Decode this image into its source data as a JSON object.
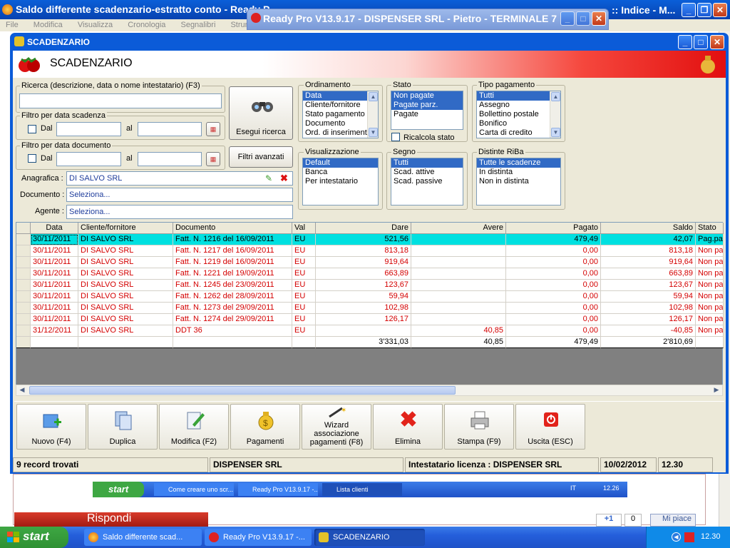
{
  "background": {
    "browser_title": "Saldo differente scadenzario-estratto conto - Ready P",
    "browser_title_right": ":: Indice - M...",
    "menu": [
      "File",
      "Modifica",
      "Visualizza",
      "Cronologia",
      "Segnalibri",
      "Strumenti"
    ],
    "readypro_title": "Ready Pro V13.9.17 - DISPENSER SRL - Pietro - TERMINALE 7",
    "reply_button": "Rispondi",
    "like_count": "0",
    "like_label": "Mi piace",
    "plus_label": "+1",
    "inner_taskbar": {
      "start": "start",
      "items": [
        "Come creare uno scr...",
        "Ready Pro V13.9.17 -...",
        "Lista clienti"
      ],
      "lang": "IT",
      "clock": "12.26"
    }
  },
  "window": {
    "title": "SCADENZARIO",
    "banner": "SCADENZARIO"
  },
  "search": {
    "label": "Ricerca (descrizione, data o nome intestatario) (F3)",
    "value": "",
    "filter_due_label": "Filtro per data scadenza",
    "filter_doc_label": "Filtro per data documento",
    "dal": "Dal",
    "al": "al",
    "run_button": "Esegui ricerca",
    "advanced_button": "Filtri avanzati"
  },
  "fields": {
    "anagrafica_label": "Anagrafica :",
    "anagrafica_value": "DI SALVO SRL",
    "documento_label": "Documento :",
    "documento_value": "Seleziona...",
    "agente_label": "Agente :",
    "agente_value": "Seleziona..."
  },
  "ordinamento": {
    "title": "Ordinamento",
    "items": [
      "Data",
      "Cliente/fornitore",
      "Stato pagamento",
      "Documento",
      "Ord. di inserimento"
    ],
    "selected": [
      0
    ]
  },
  "stato": {
    "title": "Stato",
    "items": [
      "Non pagate",
      "Pagate parz.",
      "Pagate"
    ],
    "selected": [
      0,
      1
    ],
    "ricalcola": "Ricalcola stato"
  },
  "tipo_pagamento": {
    "title": "Tipo pagamento",
    "items": [
      "Tutti",
      "Assegno",
      "Bollettino postale",
      "Bonifico",
      "Carta di credito"
    ],
    "selected": [
      0
    ]
  },
  "visualizzazione": {
    "title": "Visualizzazione",
    "items": [
      "Default",
      "Banca",
      "Per intestatario"
    ],
    "selected": [
      0
    ]
  },
  "segno": {
    "title": "Segno",
    "items": [
      "Tutti",
      "Scad. attive",
      "Scad. passive"
    ],
    "selected": [
      0
    ]
  },
  "distinte": {
    "title": "Distinte RiBa",
    "items": [
      "Tutte le scadenze",
      "In distinta",
      "Non in distinta"
    ],
    "selected": [
      0
    ]
  },
  "grid": {
    "columns": [
      "Data",
      "Cliente/fornitore",
      "Documento",
      "Val",
      "Dare",
      "Avere",
      "Pagato",
      "Saldo",
      "Stato"
    ],
    "rows": [
      [
        "30/11/2011",
        "DI SALVO SRL",
        "Fatt. N. 1216 del 16/09/2011",
        "EU",
        "521,56",
        "",
        "479,49",
        "42,07",
        "Pag.parz."
      ],
      [
        "30/11/2011",
        "DI SALVO SRL",
        "Fatt. N. 1217 del 16/09/2011",
        "EU",
        "813,18",
        "",
        "0,00",
        "813,18",
        "Non pagata"
      ],
      [
        "30/11/2011",
        "DI SALVO SRL",
        "Fatt. N. 1219 del 16/09/2011",
        "EU",
        "919,64",
        "",
        "0,00",
        "919,64",
        "Non pagata"
      ],
      [
        "30/11/2011",
        "DI SALVO SRL",
        "Fatt. N. 1221 del 19/09/2011",
        "EU",
        "663,89",
        "",
        "0,00",
        "663,89",
        "Non pagata"
      ],
      [
        "30/11/2011",
        "DI SALVO SRL",
        "Fatt. N. 1245 del 23/09/2011",
        "EU",
        "123,67",
        "",
        "0,00",
        "123,67",
        "Non pagata"
      ],
      [
        "30/11/2011",
        "DI SALVO SRL",
        "Fatt. N. 1262 del 28/09/2011",
        "EU",
        "59,94",
        "",
        "0,00",
        "59,94",
        "Non pagata"
      ],
      [
        "30/11/2011",
        "DI SALVO SRL",
        "Fatt. N. 1273 del 29/09/2011",
        "EU",
        "102,98",
        "",
        "0,00",
        "102,98",
        "Non pagata"
      ],
      [
        "30/11/2011",
        "DI SALVO SRL",
        "Fatt. N. 1274 del 29/09/2011",
        "EU",
        "126,17",
        "",
        "0,00",
        "126,17",
        "Non pagata"
      ],
      [
        "31/12/2011",
        "DI SALVO SRL",
        "DDT 36",
        "EU",
        "",
        "40,85",
        "0,00",
        "-40,85",
        "Non pagata"
      ]
    ],
    "totals": {
      "dare": "3'331,03",
      "avere": "40,85",
      "pagato": "479,49",
      "saldo": "2'810,69"
    }
  },
  "toolbar": [
    {
      "label": "Nuovo (F4)",
      "icon": "new-icon"
    },
    {
      "label": "Duplica",
      "icon": "duplicate-icon"
    },
    {
      "label": "Modifica (F2)",
      "icon": "edit-icon"
    },
    {
      "label": "Pagamenti",
      "icon": "money-bag-icon"
    },
    {
      "label": "Wizard associazione pagamenti (F8)",
      "icon": "wizard-icon"
    },
    {
      "label": "Elimina",
      "icon": "delete-icon"
    },
    {
      "label": "Stampa (F9)",
      "icon": "printer-icon"
    },
    {
      "label": "Uscita (ESC)",
      "icon": "exit-icon"
    }
  ],
  "status": {
    "records": "9 record trovati",
    "company": "DISPENSER SRL",
    "license": "Intestatario licenza : DISPENSER SRL",
    "date": "10/02/2012",
    "time": "12.30"
  },
  "taskbar": {
    "start": "start",
    "items": [
      "Saldo differente scad...",
      "Ready Pro V13.9.17 -...",
      "SCADENZARIO"
    ],
    "lang": "IT",
    "clock": "12.30"
  },
  "colors": {
    "accent": "#0b5bd8",
    "row_text": "#d40000",
    "highlight_row": "#00e0e0",
    "selection": "#316ac5"
  }
}
